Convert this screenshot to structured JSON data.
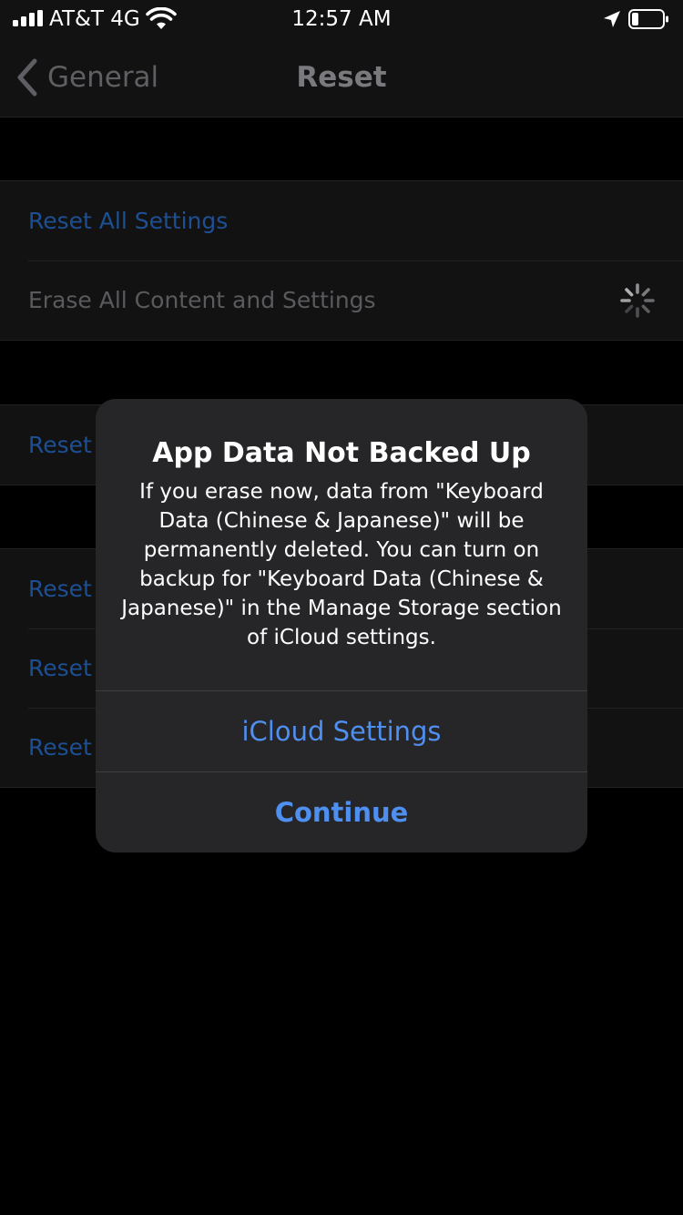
{
  "status_bar": {
    "carrier": "AT&T 4G",
    "time": "12:57 AM",
    "icons": [
      "signal-icon",
      "wifi-icon",
      "location-arrow-icon",
      "battery-icon"
    ]
  },
  "nav": {
    "back_label": "General",
    "title": "Reset"
  },
  "groups": {
    "first": {
      "reset_all_settings": "Reset All Settings",
      "erase_all_content": "Erase All Content and Settings"
    },
    "second": {
      "item_1": "Reset"
    },
    "third": {
      "item_1": "Reset",
      "item_2": "Reset",
      "item_3": "Reset"
    }
  },
  "alert": {
    "title": "App Data Not Backed Up",
    "message": "If you erase now, data from \"Keyboard Data (Chinese & Japanese)\" will be permanently deleted. You can turn on backup for \"Keyboard Data (Chinese & Japanese)\" in the Manage Storage section of iCloud settings.",
    "buttons": {
      "icloud_settings": "iCloud Settings",
      "continue": "Continue"
    }
  },
  "colors": {
    "accent": "#4f8ff0",
    "dimmed_accent": "#1d4f93",
    "background": "#000000",
    "alert_background": "#262628"
  }
}
